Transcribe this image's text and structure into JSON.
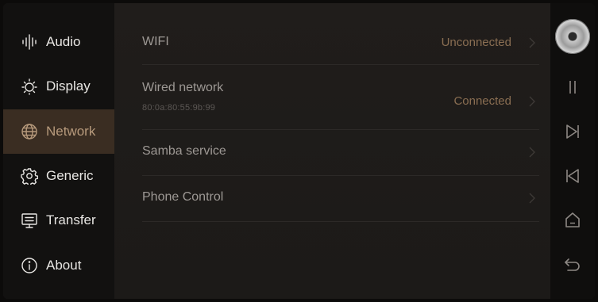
{
  "sidebar": {
    "items": [
      {
        "label": "Audio",
        "icon": "audio-wave-icon"
      },
      {
        "label": "Display",
        "icon": "brightness-icon"
      },
      {
        "label": "Network",
        "icon": "globe-icon",
        "active": true
      },
      {
        "label": "Generic",
        "icon": "gear-icon"
      },
      {
        "label": "Transfer",
        "icon": "monitor-transfer-icon"
      },
      {
        "label": "About",
        "icon": "info-icon"
      }
    ]
  },
  "network": {
    "rows": [
      {
        "title": "WIFI",
        "status": "Unconnected"
      },
      {
        "title": "Wired network",
        "subtitle": "80:0a:80:55:9b:99",
        "status": "Connected"
      },
      {
        "title": "Samba service",
        "status": ""
      },
      {
        "title": "Phone Control",
        "status": ""
      }
    ]
  },
  "rail": {
    "buttons": [
      "album-disc",
      "pause-icon",
      "next-track-icon",
      "previous-track-icon",
      "home-icon",
      "back-icon"
    ]
  },
  "colors": {
    "accent": "#b79a7c",
    "active_bg": "#3a2d22",
    "status": "#8a6e52"
  }
}
